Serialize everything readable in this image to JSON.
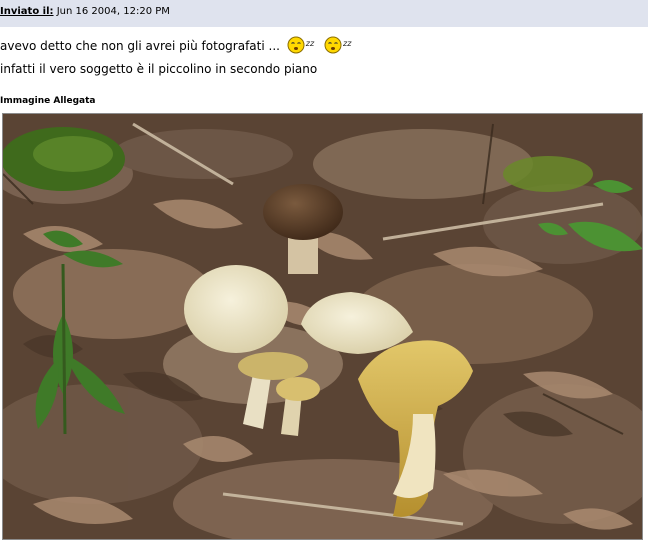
{
  "post": {
    "posted_label": "Inviato il:",
    "posted_date": "Jun 16 2004, 12:20 PM",
    "line1": "avevo detto che non gli avrei più fotografati ...",
    "sleep_text": "zz",
    "line2": "infatti il vero soggetto è il piccolino in secondo piano"
  },
  "attachment": {
    "title": "Immagine Allegata"
  },
  "icons": [
    "sleeping-smiley-icon",
    "sleeping-smiley-icon"
  ]
}
